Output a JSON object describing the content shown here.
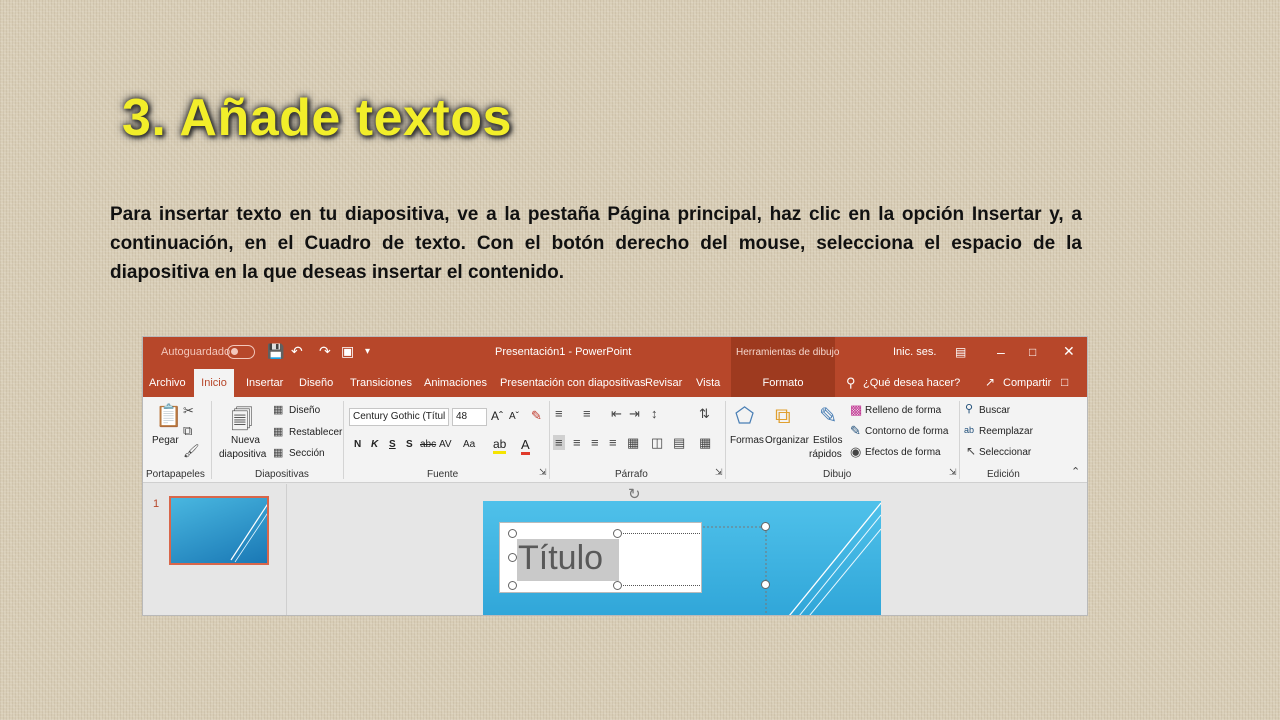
{
  "slide": {
    "title": "3. Añade textos",
    "body": "Para insertar texto en tu diapositiva, ve a la pestaña Página principal, haz clic en la opción Insertar y, a continuación, en el Cuadro de texto. Con el botón derecho del mouse, selecciona el espacio de la diapositiva en la que deseas insertar el contenido."
  },
  "app": {
    "autosave_label": "Autoguardado",
    "window_title": "Presentación1  -  PowerPoint",
    "drawing_tools": "Herramientas de dibujo",
    "signin": "Inic. ses.",
    "tabs": [
      "Archivo",
      "Inicio",
      "Insertar",
      "Diseño",
      "Transiciones",
      "Animaciones",
      "Presentación con diapositivas",
      "Revisar",
      "Vista",
      "Formato"
    ],
    "search_placeholder": "¿Qué desea hacer?",
    "share": "Compartir"
  },
  "ribbon": {
    "clipboard": {
      "paste": "Pegar",
      "label": "Portapapeles"
    },
    "slides": {
      "new_slide_line1": "Nueva",
      "new_slide_line2": "diapositiva",
      "layout": "Diseño",
      "reset": "Restablecer",
      "section": "Sección",
      "label": "Diapositivas"
    },
    "font": {
      "name": "Century Gothic (Títul",
      "size": "48",
      "bold": "N",
      "italic": "K",
      "underline": "S",
      "shadow": "S",
      "strike": "abc",
      "spacing": "AV",
      "case": "Aa",
      "label": "Fuente"
    },
    "paragraph": {
      "label": "Párrafo"
    },
    "drawing": {
      "shapes": "Formas",
      "arrange": "Organizar",
      "styles_line1": "Estilos",
      "styles_line2": "rápidos",
      "fill": "Relleno de forma",
      "outline": "Contorno de forma",
      "effects": "Efectos de forma",
      "label": "Dibujo"
    },
    "editing": {
      "find": "Buscar",
      "replace": "Reemplazar",
      "select": "Seleccionar",
      "label": "Edición"
    }
  },
  "workspace": {
    "slide_number": "1",
    "placeholder_title": "Título"
  }
}
